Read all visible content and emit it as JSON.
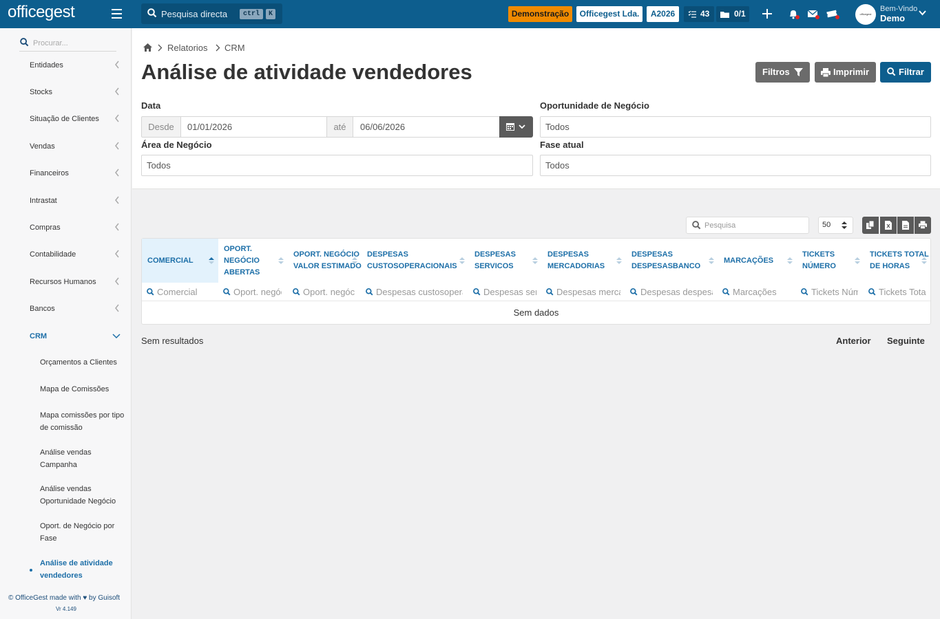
{
  "brand": {
    "logo": "officegest"
  },
  "topbar": {
    "search_placeholder": "Pesquisa directa",
    "kbd_ctrl": "ctrl",
    "kbd_k": "K",
    "demo_badge": "Demonstração",
    "company": "Officegest Lda.",
    "year": "A2026",
    "tasks_count": "43",
    "docs_count": "0/1",
    "welcome": "Bem-Vindo",
    "user": "Demo",
    "avatar_text": "officegest",
    "accent": "#0d5e8e",
    "badge_color": "#f08a00"
  },
  "sidebar": {
    "search_placeholder": "Procurar...",
    "items": [
      {
        "label": "Entidades"
      },
      {
        "label": "Stocks"
      },
      {
        "label": "Situação de Clientes"
      },
      {
        "label": "Vendas"
      },
      {
        "label": "Financeiros"
      },
      {
        "label": "Intrastat"
      },
      {
        "label": "Compras"
      },
      {
        "label": "Contabilidade"
      },
      {
        "label": "Recursos Humanos"
      },
      {
        "label": "Bancos"
      },
      {
        "label": "CRM"
      }
    ],
    "crm_sub": [
      {
        "label": "Orçamentos a Clientes"
      },
      {
        "label": "Mapa de Comissões"
      },
      {
        "label": "Mapa comissões por tipo de comissão"
      },
      {
        "label": "Análise vendas Campanha"
      },
      {
        "label": "Análise vendas Oportunidade Negócio"
      },
      {
        "label": "Oport. de Negócio por Fase"
      },
      {
        "label": "Análise de atividade vendedores"
      }
    ],
    "footer_text": "© OfficeGest made with ♥ by Guisoft",
    "version": "Vr 4.149"
  },
  "breadcrumb": {
    "level1": "Relatorios",
    "level2": "CRM"
  },
  "page": {
    "title": "Análise de atividade vendedores",
    "btn_filters": "Filtros",
    "btn_print": "Imprimir",
    "btn_filter": "Filtrar"
  },
  "form": {
    "date_label": "Data",
    "from_addon": "Desde",
    "from_value": "01/01/2026",
    "to_addon": "até",
    "to_value": "06/06/2026",
    "opportunity_label": "Oportunidade de Negócio",
    "opportunity_value": "Todos",
    "area_label": "Área de Negócio",
    "area_value": "Todos",
    "phase_label": "Fase atual",
    "phase_value": "Todos"
  },
  "table": {
    "search_placeholder": "Pesquisa",
    "page_size": "50",
    "columns": [
      {
        "header": "COMERCIAL",
        "filter": "Comercial"
      },
      {
        "header": "OPORT. NEGÓCIO ABERTAS",
        "filter": "Oport. negócio abertas"
      },
      {
        "header": "OPORT. NEGÓCIO VALOR ESTIMADO",
        "filter": "Oport. negócio valor estimado"
      },
      {
        "header": "DESPESAS CUSTOSOPERACIONAIS",
        "filter": "Despesas custosoperacionais"
      },
      {
        "header": "DESPESAS SERVICOS",
        "filter": "Despesas servicos"
      },
      {
        "header": "DESPESAS MERCADORIAS",
        "filter": "Despesas mercadorias"
      },
      {
        "header": "DESPESAS DESPESASBANCO",
        "filter": "Despesas despesasbanco"
      },
      {
        "header": "MARCAÇÕES",
        "filter": "Marcações"
      },
      {
        "header": "TICKETS NÚMERO",
        "filter": "Tickets Número"
      },
      {
        "header": "TICKETS TOTAL DE HORAS",
        "filter": "Tickets Total de horas"
      }
    ],
    "empty_text": "Sem dados",
    "results_text": "Sem resultados",
    "prev": "Anterior",
    "next": "Seguinte"
  }
}
